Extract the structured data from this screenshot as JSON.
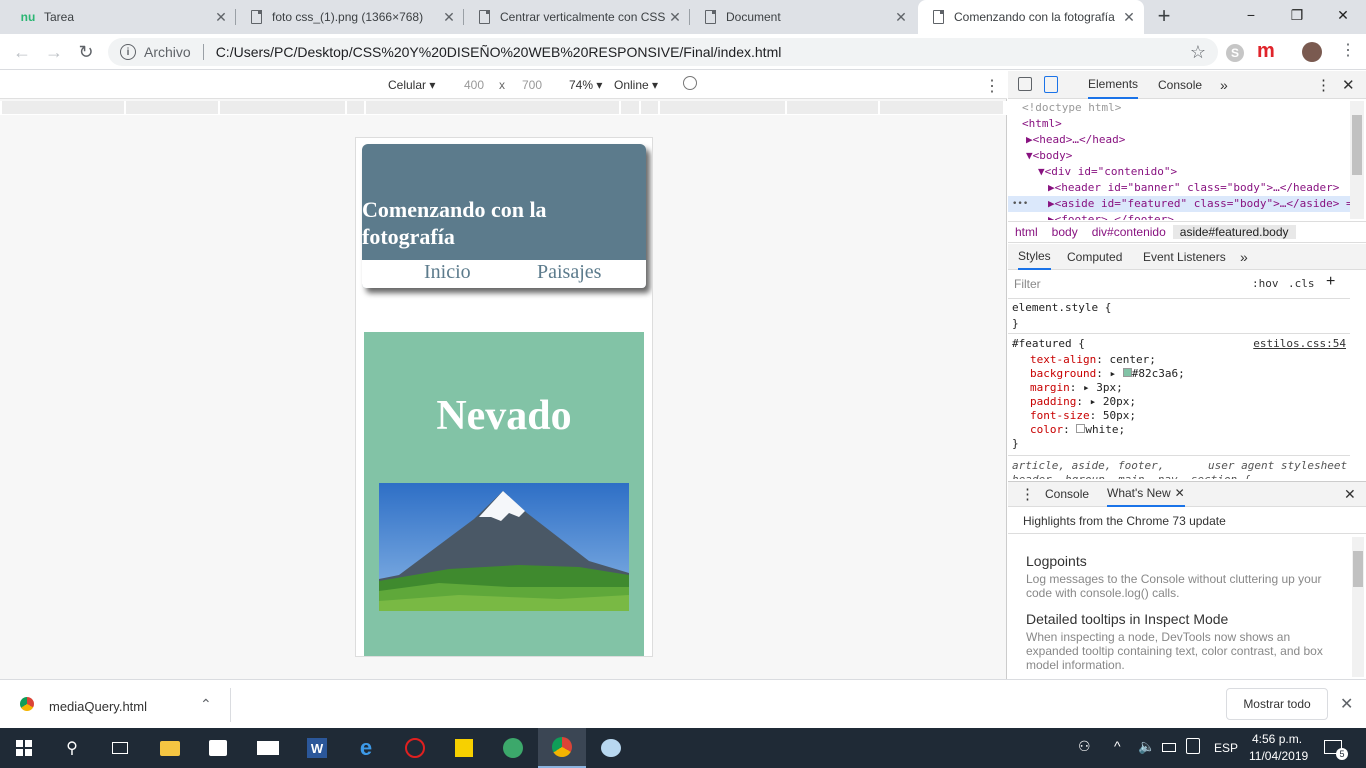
{
  "tabs": [
    {
      "title": "Tarea",
      "icon": "nu-icon"
    },
    {
      "title": "foto css_(1).png (1366×768)",
      "icon": "document-icon"
    },
    {
      "title": "Centrar verticalmente con CSS",
      "icon": "document-icon"
    },
    {
      "title": "Document",
      "icon": "document-icon"
    },
    {
      "title": "Comenzando con la fotografía",
      "icon": "document-icon",
      "active": true
    }
  ],
  "tab_logo_text": "nu",
  "new_tab_symbol": "+",
  "window": {
    "minimize": "−",
    "maximize": "❐",
    "close": "✕"
  },
  "omnibox": {
    "label": "Archivo",
    "url": "C:/Users/PC/Desktop/CSS%20Y%20DISEÑO%20WEB%20RESPONSIVE/Final/index.html"
  },
  "extension_letter": "m",
  "device_toolbar": {
    "device": "Celular",
    "width": "400",
    "times": "x",
    "height": "700",
    "zoom": "74%",
    "network": "Online"
  },
  "page": {
    "banner_title": "Comenzando con la fotografía",
    "menu": [
      "Inicio",
      "Paisajes"
    ],
    "featured_title": "Nevado"
  },
  "devtools": {
    "tabs": [
      "Elements",
      "Console"
    ],
    "more": "»",
    "dom": [
      {
        "text": "<!doctype html>",
        "indent": 0
      },
      {
        "text": "<html>",
        "indent": 0
      },
      {
        "text": "▶<head>…</head>",
        "indent": 1
      },
      {
        "text": "▼<body>",
        "indent": 1
      },
      {
        "text": "▼<div id=\"contenido\">",
        "indent": 2
      },
      {
        "text": "▶<header id=\"banner\" class=\"body\">…</header>",
        "indent": 3
      },
      {
        "text": "▶<aside id=\"featured\" class=\"body\">…</aside> == $0",
        "indent": 3,
        "selected": true
      },
      {
        "text": "▶<footer>…</footer>",
        "indent": 3
      }
    ],
    "ellipsis": "•••",
    "breadcrumbs": [
      "html",
      "body",
      "div#contenido",
      "aside#featured.body"
    ],
    "sidebar_tabs": [
      "Styles",
      "Computed",
      "Event Listeners",
      "»"
    ],
    "filter_placeholder": "Filter",
    "hov": ":hov",
    "cls": ".cls",
    "add": "+",
    "element_style": "element.style {",
    "close_brace": "}",
    "rule_selector": "#featured {",
    "rule_source": "estilos.css:54",
    "declarations": [
      {
        "prop": "text-align",
        "value": "center;"
      },
      {
        "prop": "background",
        "value": "#82c3a6;",
        "swatch": "#82c3a6",
        "arrow": true
      },
      {
        "prop": "margin",
        "value": "3px;",
        "arrow": true
      },
      {
        "prop": "padding",
        "value": "20px;",
        "arrow": true
      },
      {
        "prop": "font-size",
        "value": "50px;"
      },
      {
        "prop": "color",
        "value": "white;",
        "swatch": "#ffffff"
      }
    ],
    "ua_selector": "article, aside, footer,",
    "ua_selector_2": "header, hgroup, main, nav, section {",
    "ua_label": "user agent stylesheet",
    "drawer_tabs": [
      "Console",
      "What's New"
    ],
    "drawer_headline": "Highlights from the Chrome 73 update",
    "whats_new": [
      {
        "title": "Logpoints",
        "body": "Log messages to the Console without cluttering up your code with console.log() calls."
      },
      {
        "title": "Detailed tooltips in Inspect Mode",
        "body": "When inspecting a node, DevTools now shows an expanded tooltip containing text, color contrast, and box model information."
      }
    ]
  },
  "download": {
    "file": "mediaQuery.html",
    "show_all": "Mostrar todo"
  },
  "taskbar": {
    "time": "4:56 p.m.",
    "date": "11/04/2019",
    "lang": "ESP",
    "notifications": "5"
  },
  "colors": {
    "banner": "#5c7b8c",
    "featured": "#82c3a6",
    "taskbar": "#1f2a36"
  }
}
